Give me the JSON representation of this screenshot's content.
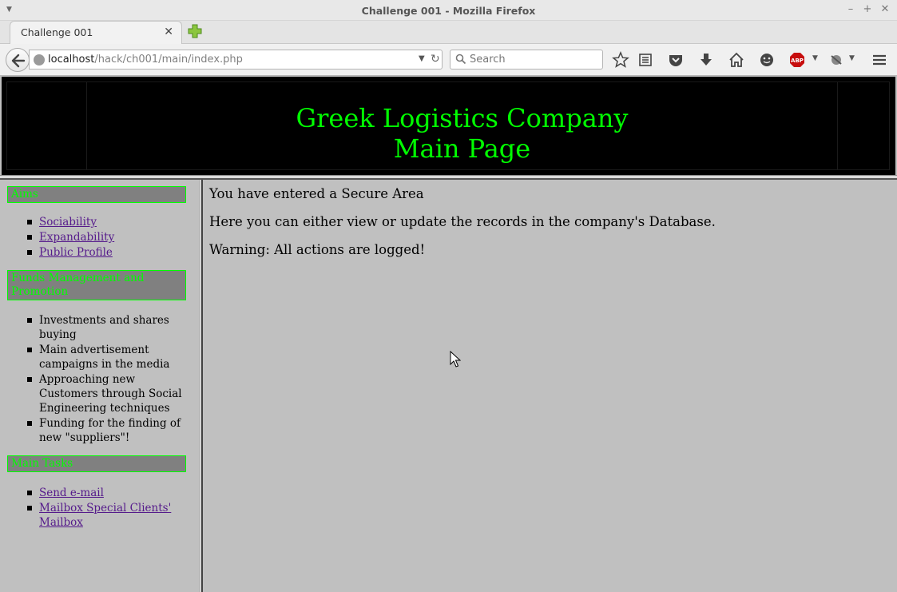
{
  "window": {
    "title": "Challenge 001 - Mozilla Firefox"
  },
  "tabs": [
    {
      "label": "Challenge 001"
    }
  ],
  "navbar": {
    "url_host": "localhost",
    "url_path": "/hack/ch001/main/index.php",
    "search_placeholder": "Search"
  },
  "page": {
    "header": {
      "line1": "Greek Logistics Company",
      "line2": "Main Page",
      "color": "#00ff00"
    },
    "sidebar": {
      "sections": [
        {
          "title": "Aims",
          "items": [
            {
              "label": "Sociability",
              "link": true
            },
            {
              "label": "Expandability",
              "link": true
            },
            {
              "label": "Public Profile",
              "link": true
            }
          ]
        },
        {
          "title": "Funds Management and Promotion",
          "items": [
            {
              "label": "Investments and shares buying",
              "link": false
            },
            {
              "label": "Main advertisement campaigns in the media",
              "link": false
            },
            {
              "label": "Approaching new Customers through Social Engineering techniques",
              "link": false
            },
            {
              "label": "Funding for the finding of new \"suppliers\"!",
              "link": false
            }
          ]
        },
        {
          "title": "Main Tasks",
          "items": [
            {
              "label": "Send e-mail",
              "link": true
            },
            {
              "label": "Mailbox Special Clients' Mailbox",
              "link": true
            }
          ]
        }
      ]
    },
    "main": {
      "line1": "You have entered a Secure Area",
      "line2": "Here you can either view or update the records in the company's Database.",
      "line3": "Warning: All actions are logged!"
    }
  }
}
